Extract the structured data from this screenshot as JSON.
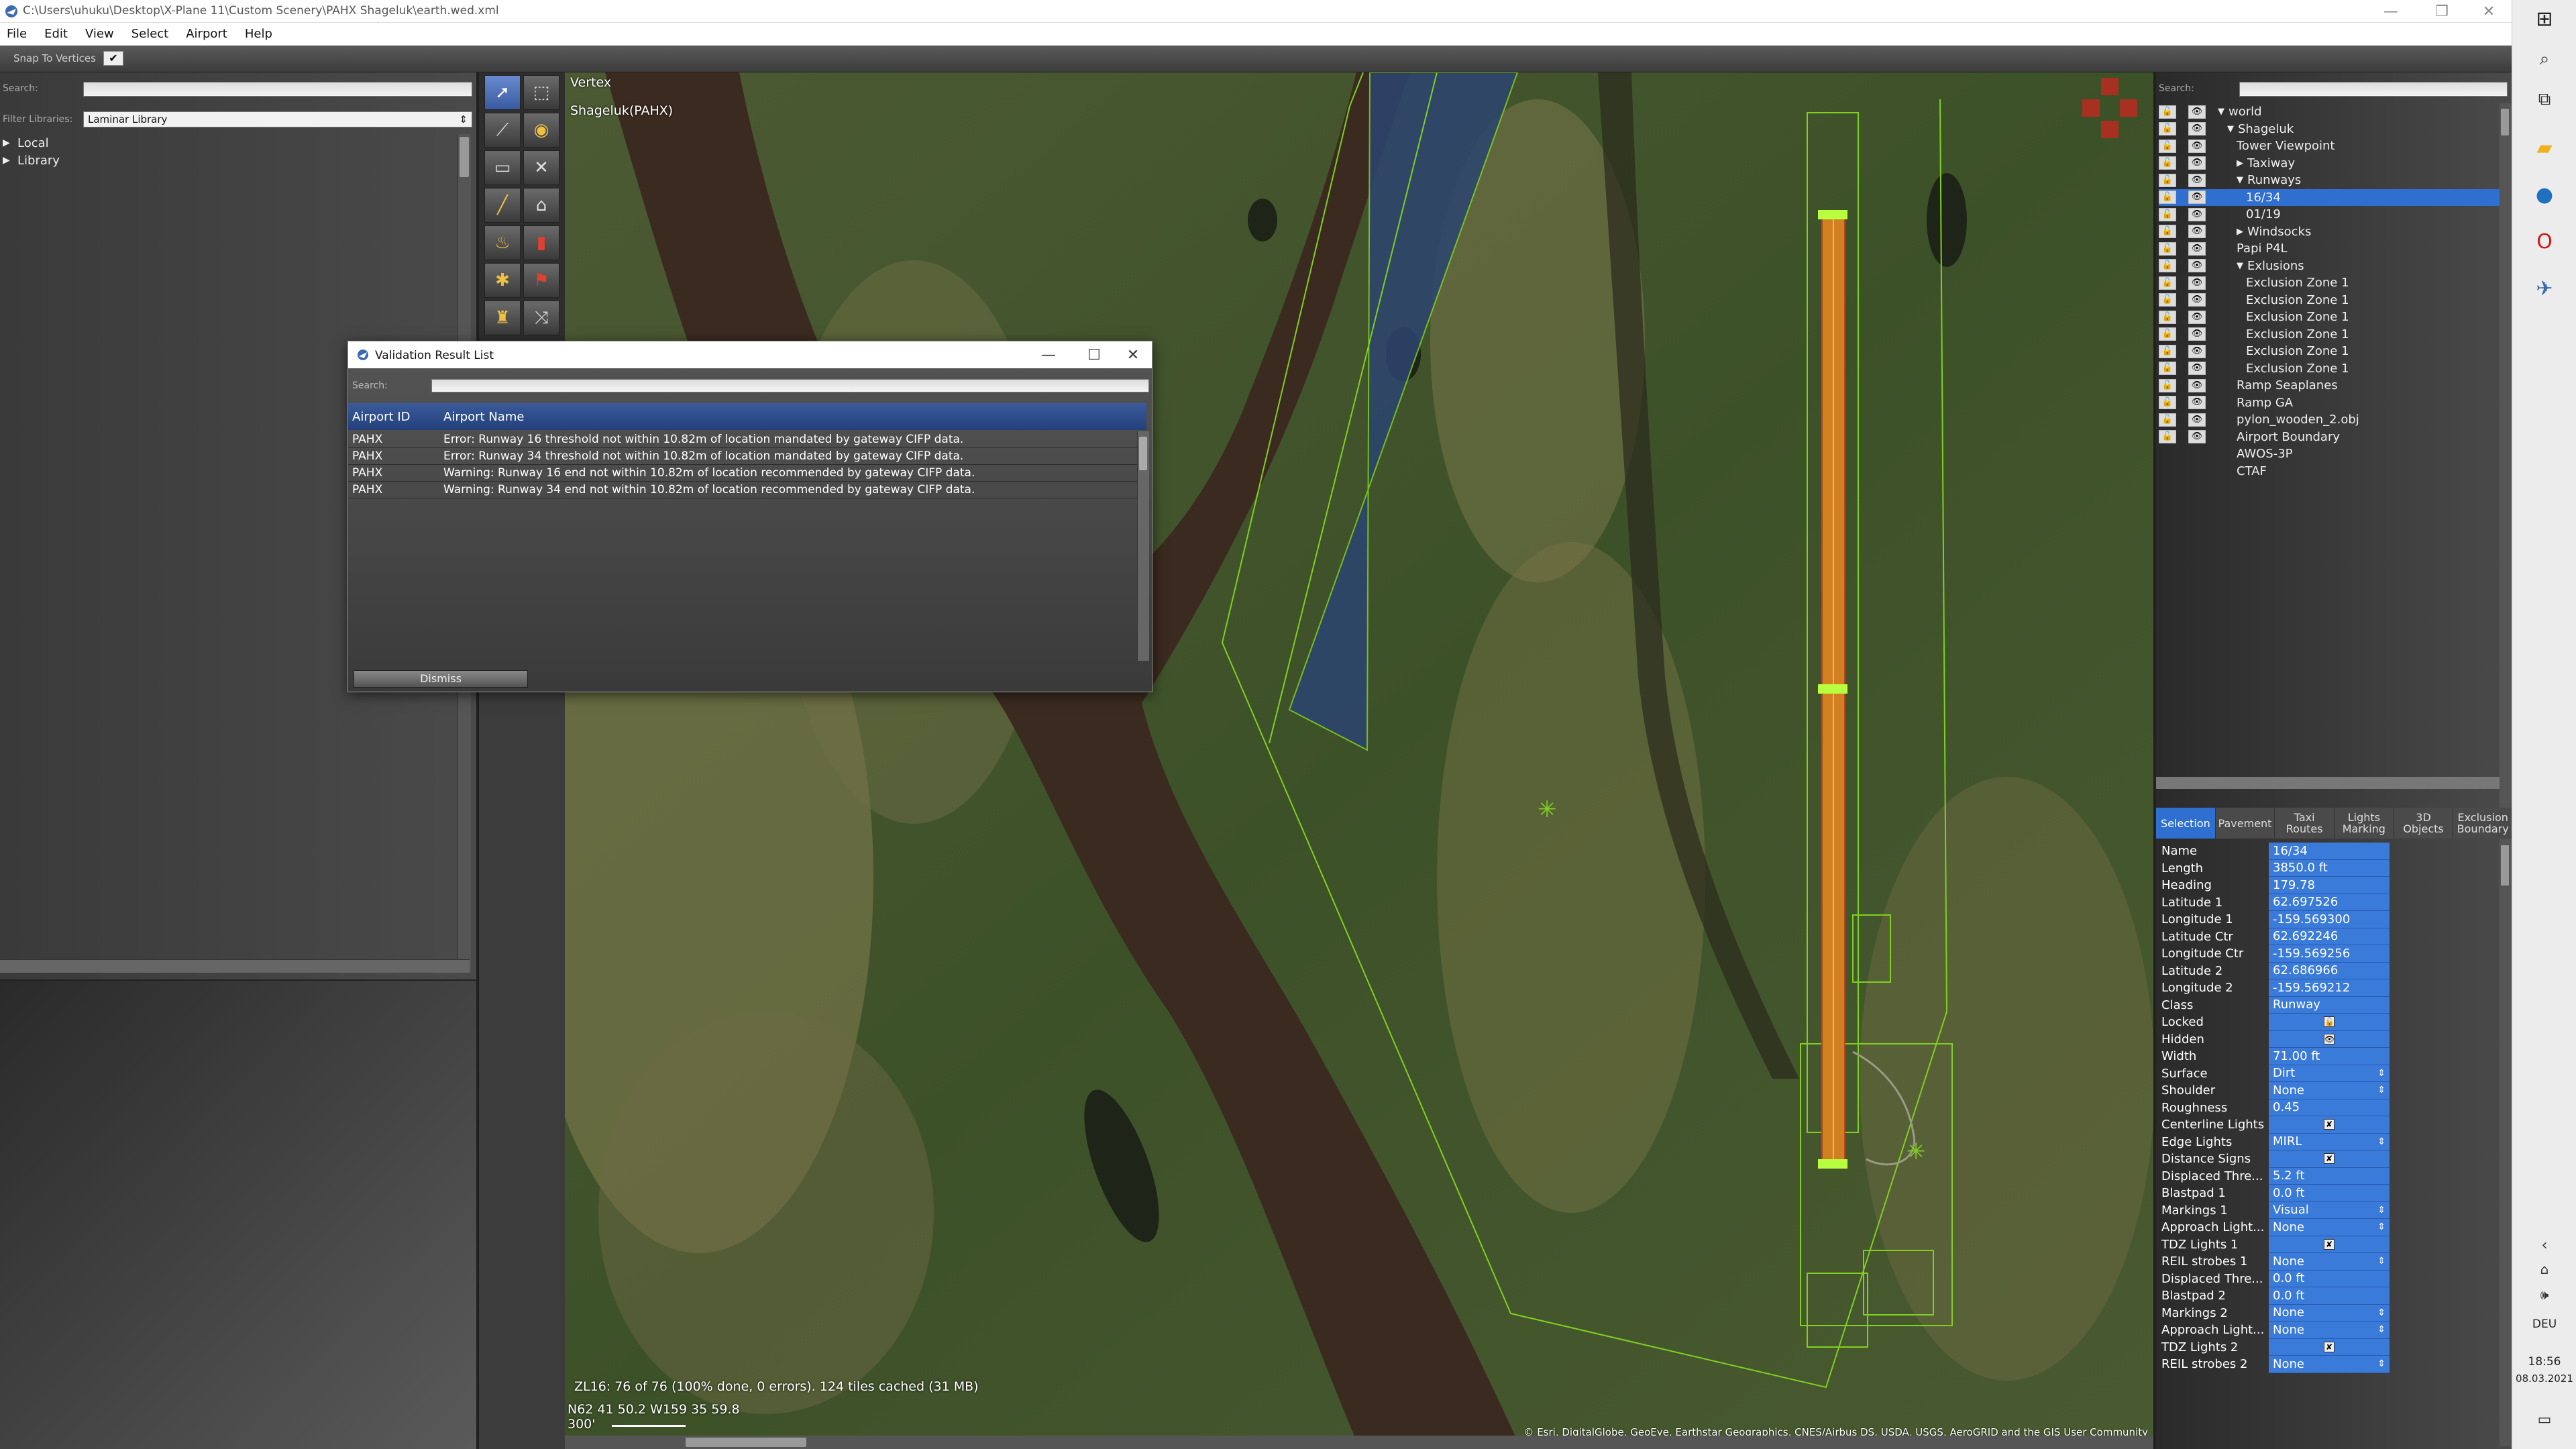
{
  "window": {
    "title": "C:\\Users\\uhuku\\Desktop\\X-Plane 11\\Custom Scenery\\PAHX Shageluk\\earth.wed.xml"
  },
  "menu": [
    "File",
    "Edit",
    "View",
    "Select",
    "Airport",
    "Help"
  ],
  "toolbar": {
    "snap_label": "Snap To Vertices",
    "snap_checked": "✔"
  },
  "library": {
    "search_label": "Search:",
    "filter_label": "Filter Libraries:",
    "filter_value": "Laminar Library",
    "items": [
      {
        "label": "Local"
      },
      {
        "label": "Library"
      }
    ]
  },
  "map": {
    "tool_name": "Vertex",
    "airport_label": "Shageluk(PAHX)",
    "status": "ZL16: 76 of 76 (100% done, 0 errors). 124 tiles cached (31 MB)",
    "coords": "N62 41 50.2 W159 35 59.8",
    "scale": "300'",
    "attribution": "© Esri, DigitalGlobe, GeoEye, Earthstar Geographics, CNES/Airbus DS, USDA, USGS, AeroGRID and the GIS User Community"
  },
  "dialog": {
    "title": "Validation Result List",
    "search_label": "Search:",
    "columns": [
      "Airport ID",
      "Airport Name"
    ],
    "rows": [
      {
        "id": "PAHX",
        "msg": "Error: Runway 16 threshold not within 10.82m of location mandated by gateway CIFP data."
      },
      {
        "id": "PAHX",
        "msg": "Error: Runway 34 threshold not within 10.82m of location mandated by gateway CIFP data."
      },
      {
        "id": "PAHX",
        "msg": "Warning: Runway 16 end not within 10.82m of location recommended by gateway CIFP data."
      },
      {
        "id": "PAHX",
        "msg": "Warning: Runway 34 end not within 10.82m of location recommended by gateway CIFP data."
      }
    ],
    "dismiss_label": "Dismiss"
  },
  "hierarchy": {
    "search_label": "Search:",
    "items": [
      {
        "label": "world",
        "tri": "▼"
      },
      {
        "label": "Shageluk",
        "tri": "▼"
      },
      {
        "label": "Tower Viewpoint",
        "tri": ""
      },
      {
        "label": "Taxiway",
        "tri": "▶"
      },
      {
        "label": "Runways",
        "tri": "▼"
      },
      {
        "label": "16/34",
        "tri": "",
        "selected": true
      },
      {
        "label": "01/19",
        "tri": ""
      },
      {
        "label": "Windsocks",
        "tri": "▶"
      },
      {
        "label": "Papi P4L",
        "tri": ""
      },
      {
        "label": "Exlusions",
        "tri": "▼"
      },
      {
        "label": "Exclusion Zone 1",
        "tri": ""
      },
      {
        "label": "Exclusion Zone 1",
        "tri": ""
      },
      {
        "label": "Exclusion Zone 1",
        "tri": ""
      },
      {
        "label": "Exclusion Zone 1",
        "tri": ""
      },
      {
        "label": "Exclusion Zone 1",
        "tri": ""
      },
      {
        "label": "Exclusion Zone 1",
        "tri": ""
      },
      {
        "label": "Ramp Seaplanes",
        "tri": ""
      },
      {
        "label": "Ramp GA",
        "tri": ""
      },
      {
        "label": "pylon_wooden_2.obj",
        "tri": ""
      },
      {
        "label": "Airport Boundary",
        "tri": ""
      },
      {
        "label": "AWOS-3P",
        "tri": "",
        "nobox": true
      },
      {
        "label": "CTAF",
        "tri": "",
        "nobox": true
      }
    ]
  },
  "tabs": [
    "Selection",
    "Pavement",
    "Taxi Routes",
    "Lights Marking",
    "3D Objects",
    "Exclusion Boundary"
  ],
  "properties": [
    {
      "label": "Name",
      "value": "16/34"
    },
    {
      "label": "Length",
      "value": "3850.0 ft"
    },
    {
      "label": "Heading",
      "value": "179.78"
    },
    {
      "label": "Latitude 1",
      "value": "62.697526"
    },
    {
      "label": "Longitude 1",
      "value": "-159.569300"
    },
    {
      "label": "Latitude Ctr",
      "value": "62.692246"
    },
    {
      "label": "Longitude Ctr",
      "value": "-159.569256"
    },
    {
      "label": "Latitude 2",
      "value": "62.686966"
    },
    {
      "label": "Longitude 2",
      "value": "-159.569212"
    },
    {
      "label": "Class",
      "value": "Runway"
    },
    {
      "label": "Locked",
      "value": "",
      "kind": "lockbox"
    },
    {
      "label": "Hidden",
      "value": "",
      "kind": "eyebox"
    },
    {
      "label": "Width",
      "value": "71.00 ft"
    },
    {
      "label": "Surface",
      "value": "Dirt",
      "kind": "select"
    },
    {
      "label": "Shoulder",
      "value": "None",
      "kind": "select"
    },
    {
      "label": "Roughness",
      "value": "0.45"
    },
    {
      "label": "Centerline Lights",
      "value": "✘",
      "kind": "check"
    },
    {
      "label": "Edge Lights",
      "value": "MIRL",
      "kind": "select"
    },
    {
      "label": "Distance Signs",
      "value": "✘",
      "kind": "check"
    },
    {
      "label": "Displaced Thre...",
      "value": "5.2 ft"
    },
    {
      "label": "Blastpad 1",
      "value": "0.0 ft"
    },
    {
      "label": "Markings 1",
      "value": "Visual",
      "kind": "select"
    },
    {
      "label": "Approach Light...",
      "value": "None",
      "kind": "select"
    },
    {
      "label": "TDZ Lights 1",
      "value": "✘",
      "kind": "check"
    },
    {
      "label": "REIL strobes 1",
      "value": "None",
      "kind": "select"
    },
    {
      "label": "Displaced Thre...",
      "value": "0.0 ft"
    },
    {
      "label": "Blastpad 2",
      "value": "0.0 ft"
    },
    {
      "label": "Markings 2",
      "value": "None",
      "kind": "select"
    },
    {
      "label": "Approach Light...",
      "value": "None",
      "kind": "select"
    },
    {
      "label": "TDZ Lights 2",
      "value": "✘",
      "kind": "check"
    },
    {
      "label": "REIL strobes 2",
      "value": "None",
      "kind": "select"
    }
  ],
  "taskbar": {
    "lang": "DEU",
    "time": "18:56",
    "date": "08.03.2021"
  },
  "colors": {
    "selection": "#2f6fd0",
    "runway": "#d08020",
    "guide": "#7fd020"
  }
}
